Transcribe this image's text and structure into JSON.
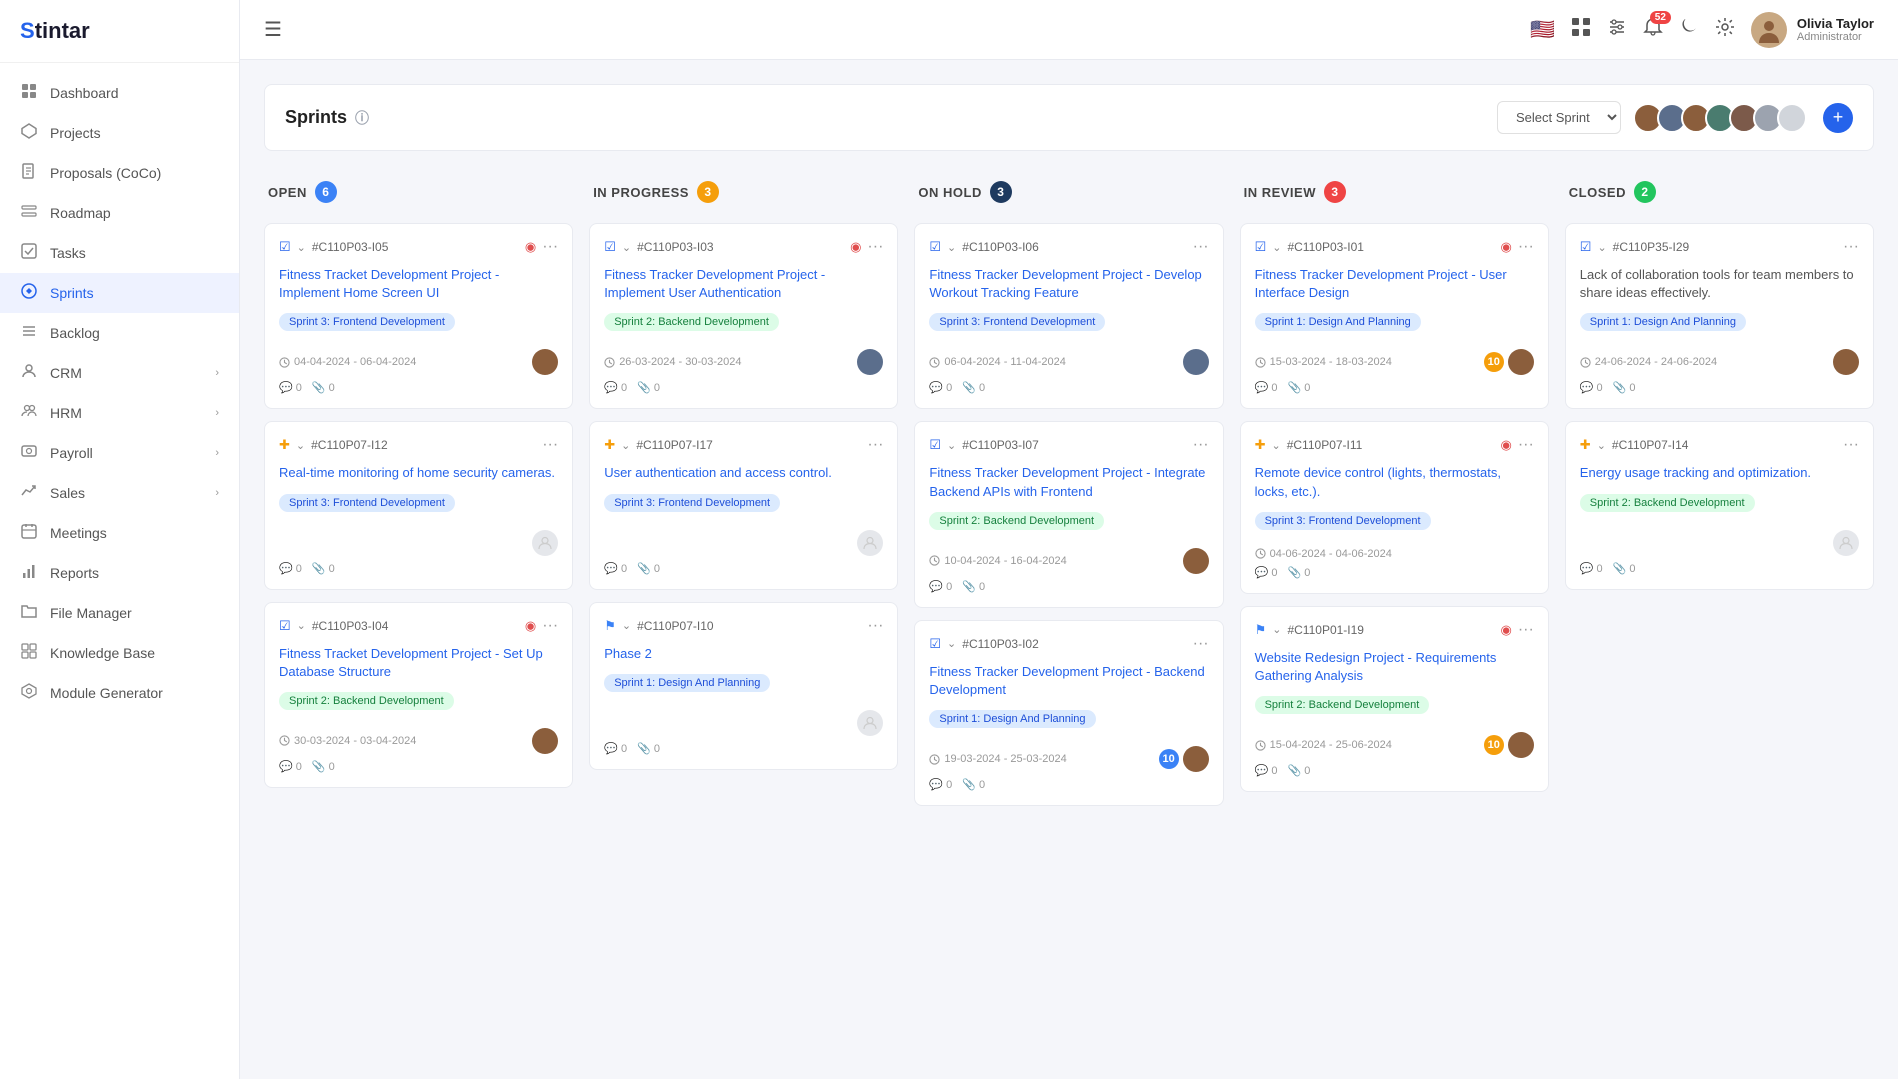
{
  "app": {
    "name": "Stintar",
    "logo_icon": "S"
  },
  "sidebar": {
    "items": [
      {
        "id": "dashboard",
        "label": "Dashboard",
        "icon": "◉",
        "active": false
      },
      {
        "id": "projects",
        "label": "Projects",
        "icon": "⬡",
        "active": false
      },
      {
        "id": "proposals",
        "label": "Proposals (CoCo)",
        "icon": "📄",
        "active": false
      },
      {
        "id": "roadmap",
        "label": "Roadmap",
        "icon": "◫",
        "active": false
      },
      {
        "id": "tasks",
        "label": "Tasks",
        "icon": "☑",
        "active": false
      },
      {
        "id": "sprints",
        "label": "Sprints",
        "icon": "⚡",
        "active": true
      },
      {
        "id": "backlog",
        "label": "Backlog",
        "icon": "≡",
        "active": false
      },
      {
        "id": "crm",
        "label": "CRM",
        "icon": "👤",
        "active": false,
        "arrow": true
      },
      {
        "id": "hrm",
        "label": "HRM",
        "icon": "👥",
        "active": false,
        "arrow": true
      },
      {
        "id": "payroll",
        "label": "Payroll",
        "icon": "💰",
        "active": false,
        "arrow": true
      },
      {
        "id": "sales",
        "label": "Sales",
        "icon": "📈",
        "active": false,
        "arrow": true
      },
      {
        "id": "meetings",
        "label": "Meetings",
        "icon": "🗓",
        "active": false
      },
      {
        "id": "reports",
        "label": "Reports",
        "icon": "📊",
        "active": false
      },
      {
        "id": "file_manager",
        "label": "File Manager",
        "icon": "📁",
        "active": false
      },
      {
        "id": "knowledge_base",
        "label": "Knowledge Base",
        "icon": "⊞",
        "active": false
      },
      {
        "id": "module_generator",
        "label": "Module Generator",
        "icon": "🎓",
        "active": false
      }
    ]
  },
  "header": {
    "menu_icon": "☰",
    "notification_count": "52",
    "user": {
      "name": "Olivia Taylor",
      "role": "Administrator"
    }
  },
  "sprints_page": {
    "title": "Sprints",
    "select_placeholder": "Select Sprint",
    "add_button": "+",
    "columns": [
      {
        "id": "open",
        "label": "OPEN",
        "count": "6",
        "badge_color": "badge-blue",
        "cards": [
          {
            "id": "card-c110p03-i05",
            "issue_id": "#C110P03-I05",
            "title": "Fitness Tracket Development Project - Implement Home Screen UI",
            "title_color": "blue",
            "sprint_tag": "Sprint 3: Frontend Development",
            "tag_color": "tag-blue-light",
            "dates": "04-04-2024 - 06-04-2024",
            "comments": "0",
            "attachments": "0",
            "has_avatar": true,
            "priority_icon": "🔴",
            "priority_color": "red"
          },
          {
            "id": "card-c110p07-i12",
            "issue_id": "#C110P07-I12",
            "title": "Real-time monitoring of home security cameras.",
            "title_color": "blue",
            "sprint_tag": "Sprint 3: Frontend Development",
            "tag_color": "tag-blue-light",
            "dates": "",
            "comments": "0",
            "attachments": "0",
            "has_avatar": false,
            "priority_icon": "➕",
            "priority_color": "yellow"
          },
          {
            "id": "card-c110p03-i04",
            "issue_id": "#C110P03-I04",
            "title": "Fitness Tracket Development Project - Set Up Database Structure",
            "title_color": "blue",
            "sprint_tag": "Sprint 2: Backend Development",
            "tag_color": "tag-green-light",
            "dates": "30-03-2024 - 03-04-2024",
            "comments": "0",
            "attachments": "0",
            "has_avatar": true,
            "priority_icon": "☑",
            "priority_color": "blue"
          }
        ]
      },
      {
        "id": "in_progress",
        "label": "IN PROGRESS",
        "count": "3",
        "badge_color": "badge-orange",
        "cards": [
          {
            "id": "card-c110p03-i03",
            "issue_id": "#C110P03-I03",
            "title": "Fitness Tracker Development Project - Implement User Authentication",
            "title_color": "blue",
            "sprint_tag": "Sprint 2: Backend Development",
            "tag_color": "tag-green-light",
            "dates": "26-03-2024 - 30-03-2024",
            "comments": "0",
            "attachments": "0",
            "has_avatar": true,
            "priority_icon": "☑",
            "priority_color": "blue"
          },
          {
            "id": "card-c110p07-i17",
            "issue_id": "#C110P07-I17",
            "title": "User authentication and access control.",
            "title_color": "blue",
            "sprint_tag": "Sprint 3: Frontend Development",
            "tag_color": "tag-blue-light",
            "dates": "",
            "comments": "0",
            "attachments": "0",
            "has_avatar": false,
            "priority_icon": "➕",
            "priority_color": "yellow"
          },
          {
            "id": "card-c110p07-i10",
            "issue_id": "#C110P07-I10",
            "title": "Phase 2",
            "title_color": "blue",
            "sprint_tag": "Sprint 1: Design And Planning",
            "tag_color": "tag-blue-light",
            "dates": "",
            "comments": "0",
            "attachments": "0",
            "has_avatar": false,
            "priority_icon": "🚩",
            "priority_color": "blue"
          }
        ]
      },
      {
        "id": "on_hold",
        "label": "ON HOLD",
        "count": "3",
        "badge_color": "badge-navy",
        "cards": [
          {
            "id": "card-c110p03-i06",
            "issue_id": "#C110P03-I06",
            "title": "Fitness Tracker Development Project - Develop Workout Tracking Feature",
            "title_color": "blue",
            "sprint_tag": "Sprint 3: Frontend Development",
            "tag_color": "tag-blue-light",
            "dates": "06-04-2024 - 11-04-2024",
            "comments": "0",
            "attachments": "0",
            "has_avatar": true,
            "priority_icon": "☑",
            "priority_color": "blue"
          },
          {
            "id": "card-c110p03-i07",
            "issue_id": "#C110P03-I07",
            "title": "Fitness Tracker Development Project - Integrate Backend APIs with Frontend",
            "title_color": "blue",
            "sprint_tag": "Sprint 2: Backend Development",
            "tag_color": "tag-green-light",
            "dates": "10-04-2024 - 16-04-2024",
            "comments": "0",
            "attachments": "0",
            "has_avatar": true,
            "priority_icon": "☑",
            "priority_color": "blue"
          },
          {
            "id": "card-c110p03-i02",
            "issue_id": "#C110P03-I02",
            "title": "Fitness Tracker Development Project - Backend Development",
            "title_color": "blue",
            "sprint_tag": "Sprint 1: Design And Planning",
            "tag_color": "tag-blue-light",
            "dates": "19-03-2024 - 25-03-2024",
            "comments": "0",
            "attachments": "0",
            "has_avatar": true,
            "has_badge": true,
            "badge_num": "10",
            "priority_icon": "☑",
            "priority_color": "blue"
          }
        ]
      },
      {
        "id": "in_review",
        "label": "IN REVIEW",
        "count": "3",
        "badge_color": "badge-red",
        "cards": [
          {
            "id": "card-c110p03-i01",
            "issue_id": "#C110P03-I01",
            "title": "Fitness Tracker Development Project - User Interface Design",
            "title_color": "blue",
            "sprint_tag": "Sprint 1: Design And Planning",
            "tag_color": "tag-blue-light",
            "dates": "15-03-2024 - 18-03-2024",
            "comments": "0",
            "attachments": "0",
            "has_avatar": true,
            "has_badge": true,
            "badge_num": "10",
            "priority_icon": "☑",
            "priority_color": "blue"
          },
          {
            "id": "card-c110p07-i11",
            "issue_id": "#C110P07-I11",
            "title": "Remote device control (lights, thermostats, locks, etc.).",
            "title_color": "blue",
            "sprint_tag": "Sprint 3: Frontend Development",
            "tag_color": "tag-blue-light",
            "dates": "04-06-2024 - 04-06-2024",
            "comments": "0",
            "attachments": "0",
            "has_avatar": false,
            "priority_icon": "➕",
            "priority_color": "yellow"
          },
          {
            "id": "card-c110p01-i19",
            "issue_id": "#C110P01-I19",
            "title": "Website Redesign Project - Requirements Gathering Analysis",
            "title_color": "blue",
            "sprint_tag": "Sprint 2: Backend Development",
            "tag_color": "tag-green-light",
            "dates": "15-04-2024 - 25-06-2024",
            "comments": "0",
            "attachments": "0",
            "has_avatar": true,
            "has_badge": true,
            "badge_num": "10",
            "priority_icon": "🚩",
            "priority_color": "blue"
          }
        ]
      },
      {
        "id": "closed",
        "label": "CLOSED",
        "count": "2",
        "badge_color": "badge-green",
        "cards": [
          {
            "id": "card-c110p35-i29",
            "issue_id": "#C110P35-I29",
            "title": "Lack of collaboration tools for team members to share ideas effectively.",
            "title_color": "gray",
            "sprint_tag": "Sprint 1: Design And Planning",
            "tag_color": "tag-blue-light",
            "dates": "24-06-2024 - 24-06-2024",
            "comments": "0",
            "attachments": "0",
            "has_avatar": true,
            "priority_icon": "☑",
            "priority_color": "blue"
          },
          {
            "id": "card-c110p07-i14",
            "issue_id": "#C110P07-I14",
            "title": "Energy usage tracking and optimization.",
            "title_color": "blue",
            "sprint_tag": "Sprint 2: Backend Development",
            "tag_color": "tag-green-light",
            "dates": "",
            "comments": "0",
            "attachments": "0",
            "has_avatar": false,
            "priority_icon": "➕",
            "priority_color": "yellow"
          }
        ]
      }
    ]
  }
}
